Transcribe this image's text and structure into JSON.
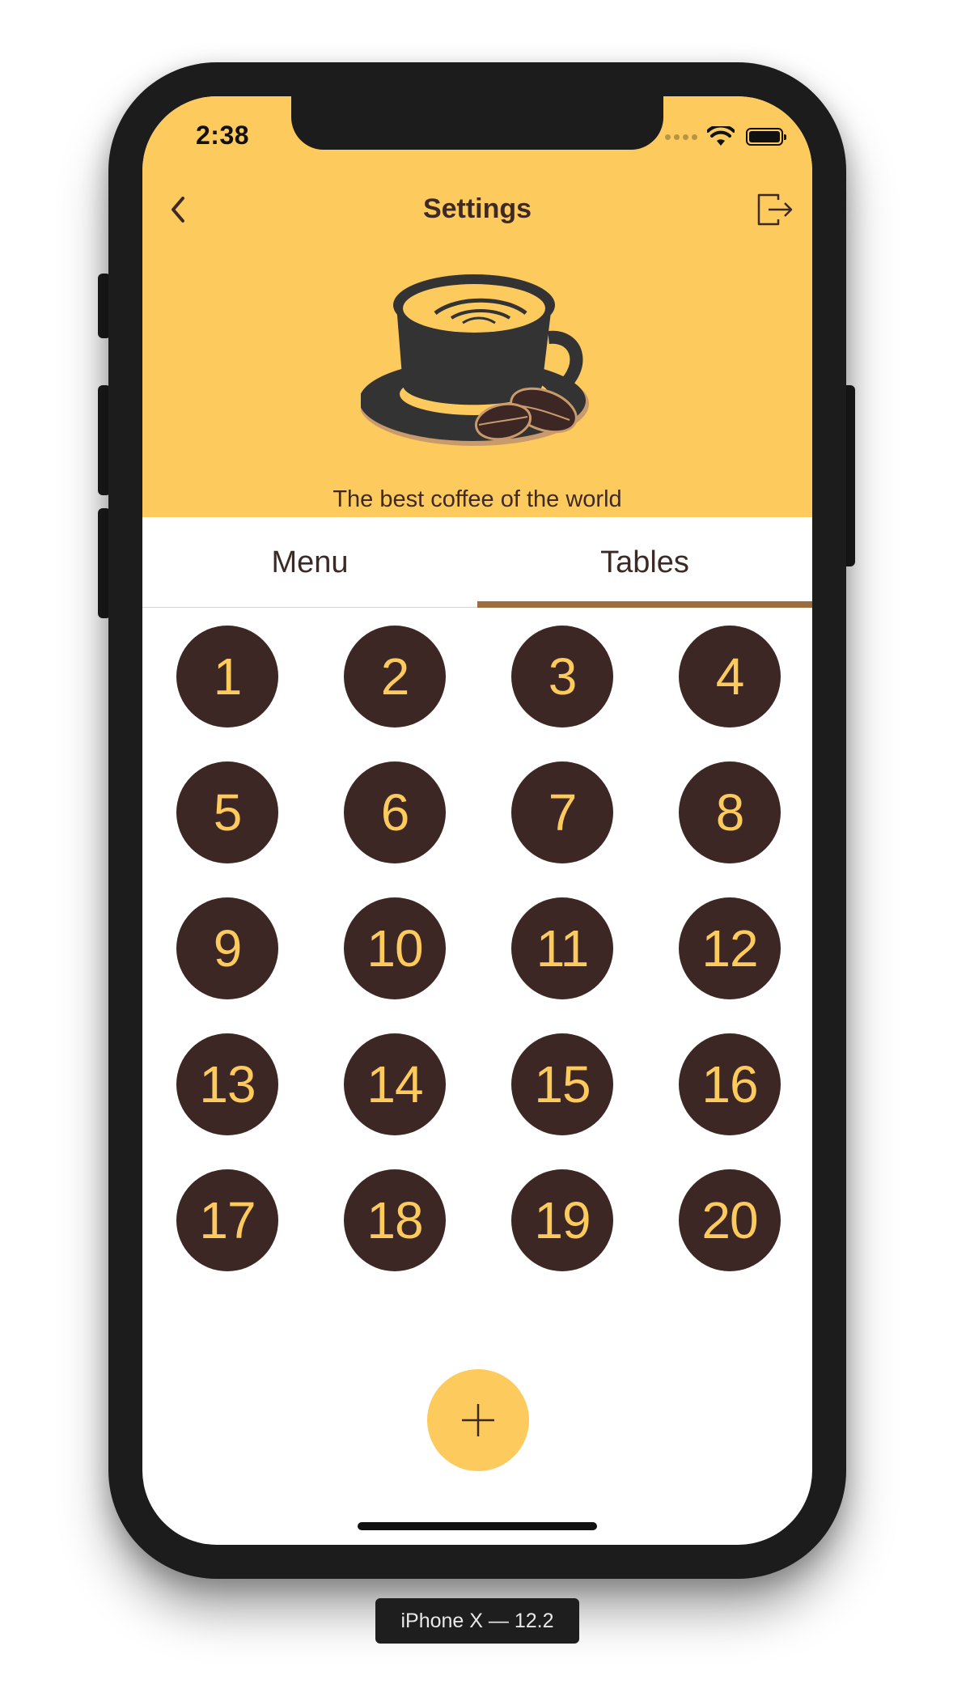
{
  "status_bar": {
    "time": "2:38",
    "icons": [
      "signal-dots-icon",
      "wifi-icon",
      "battery-icon"
    ]
  },
  "nav": {
    "back_icon": "chevron-left-icon",
    "title": "Settings",
    "logout_icon": "logout-icon"
  },
  "header": {
    "logo_icon": "coffee-cup-icon",
    "tagline": "The best coffee of the world"
  },
  "tabs": [
    {
      "label": "Menu",
      "selected": false
    },
    {
      "label": "Tables",
      "selected": true
    }
  ],
  "tables": [
    "1",
    "2",
    "3",
    "4",
    "5",
    "6",
    "7",
    "8",
    "9",
    "10",
    "11",
    "12",
    "13",
    "14",
    "15",
    "16",
    "17",
    "18",
    "19",
    "20"
  ],
  "fab": {
    "icon": "plus-icon"
  },
  "simulator_label": "iPhone X — 12.2",
  "colors": {
    "accent_yellow": "#fdca5d",
    "dark_brown": "#3c2725",
    "text_brown": "#3d2a27",
    "tab_indicator": "#9b6d3f"
  }
}
